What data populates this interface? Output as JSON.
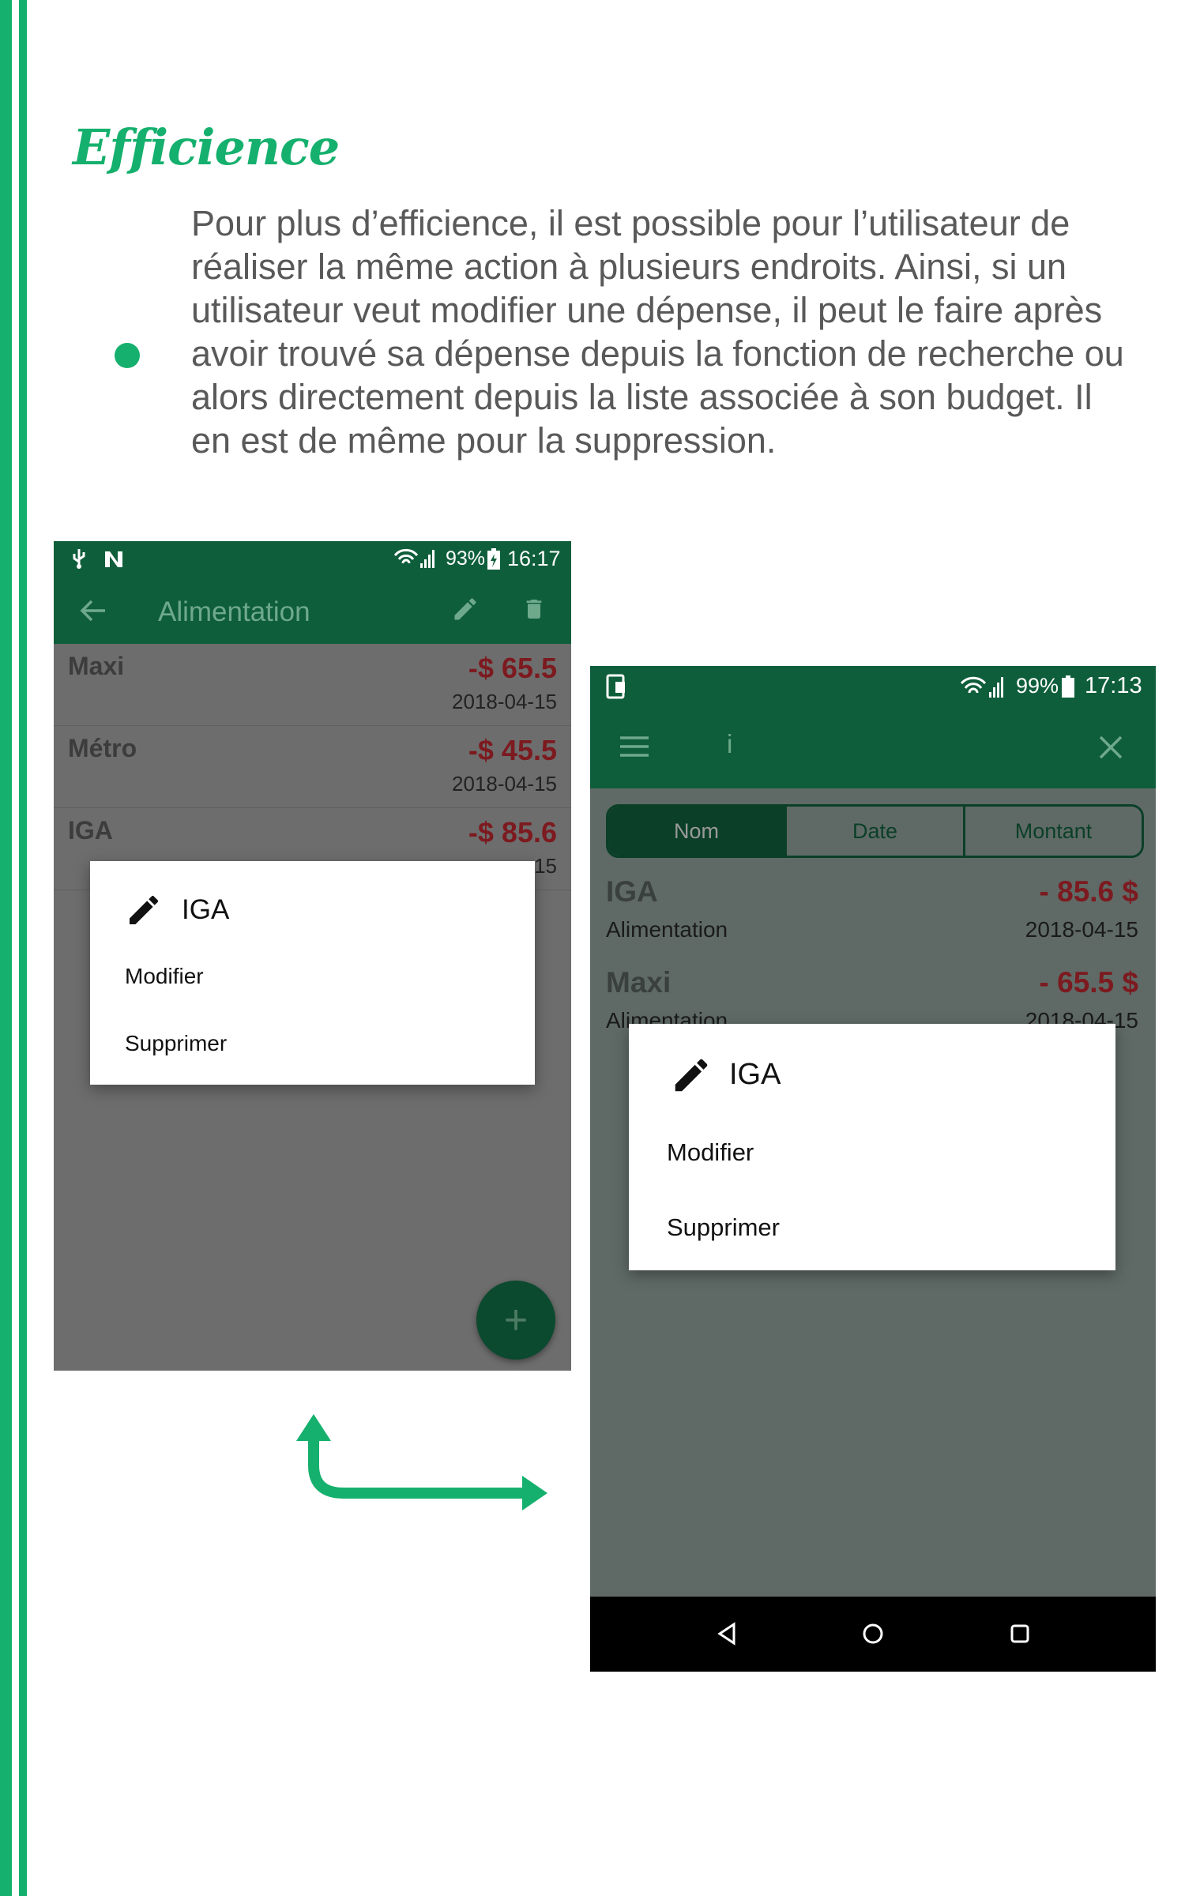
{
  "section_title": "Efficience",
  "paragraph": "Pour plus d’efficience, il est possible pour l’utilisateur de réaliser la même action à plusieurs endroits. Ainsi, si un utilisateur veut modifier une dépense, il peut le faire après avoir trouvé sa dépense depuis la fonction de recherche ou alors directement depuis la liste associée à son budget. Il en est de même pour la suppression.",
  "colors": {
    "accent": "#15b06d",
    "appbar": "#0f5e3b",
    "expense_red": "#a0141e"
  },
  "phone1": {
    "status": {
      "battery": "93%",
      "time": "16:17"
    },
    "title": "Alimentation",
    "items": [
      {
        "name": "Maxi",
        "amount": "-$ 65.5",
        "date": "2018-04-15"
      },
      {
        "name": "Métro",
        "amount": "-$ 45.5",
        "date": "2018-04-15"
      },
      {
        "name": "IGA",
        "amount": "-$ 85.6",
        "date": "15"
      }
    ],
    "dialog": {
      "title": "IGA",
      "modify": "Modifier",
      "delete": "Supprimer"
    },
    "fab": "+"
  },
  "phone2": {
    "status": {
      "battery": "99%",
      "time": "17:13"
    },
    "search_text": "i",
    "tabs": [
      "Nom",
      "Date",
      "Montant"
    ],
    "results": [
      {
        "name": "IGA",
        "category": "Alimentation",
        "amount": "- 85.6 $",
        "date": "2018-04-15"
      },
      {
        "name": "Maxi",
        "category": "Alimentation",
        "amount": "- 65.5 $",
        "date": "2018-04-15"
      }
    ],
    "dialog": {
      "title": "IGA",
      "modify": "Modifier",
      "delete": "Supprimer"
    }
  }
}
